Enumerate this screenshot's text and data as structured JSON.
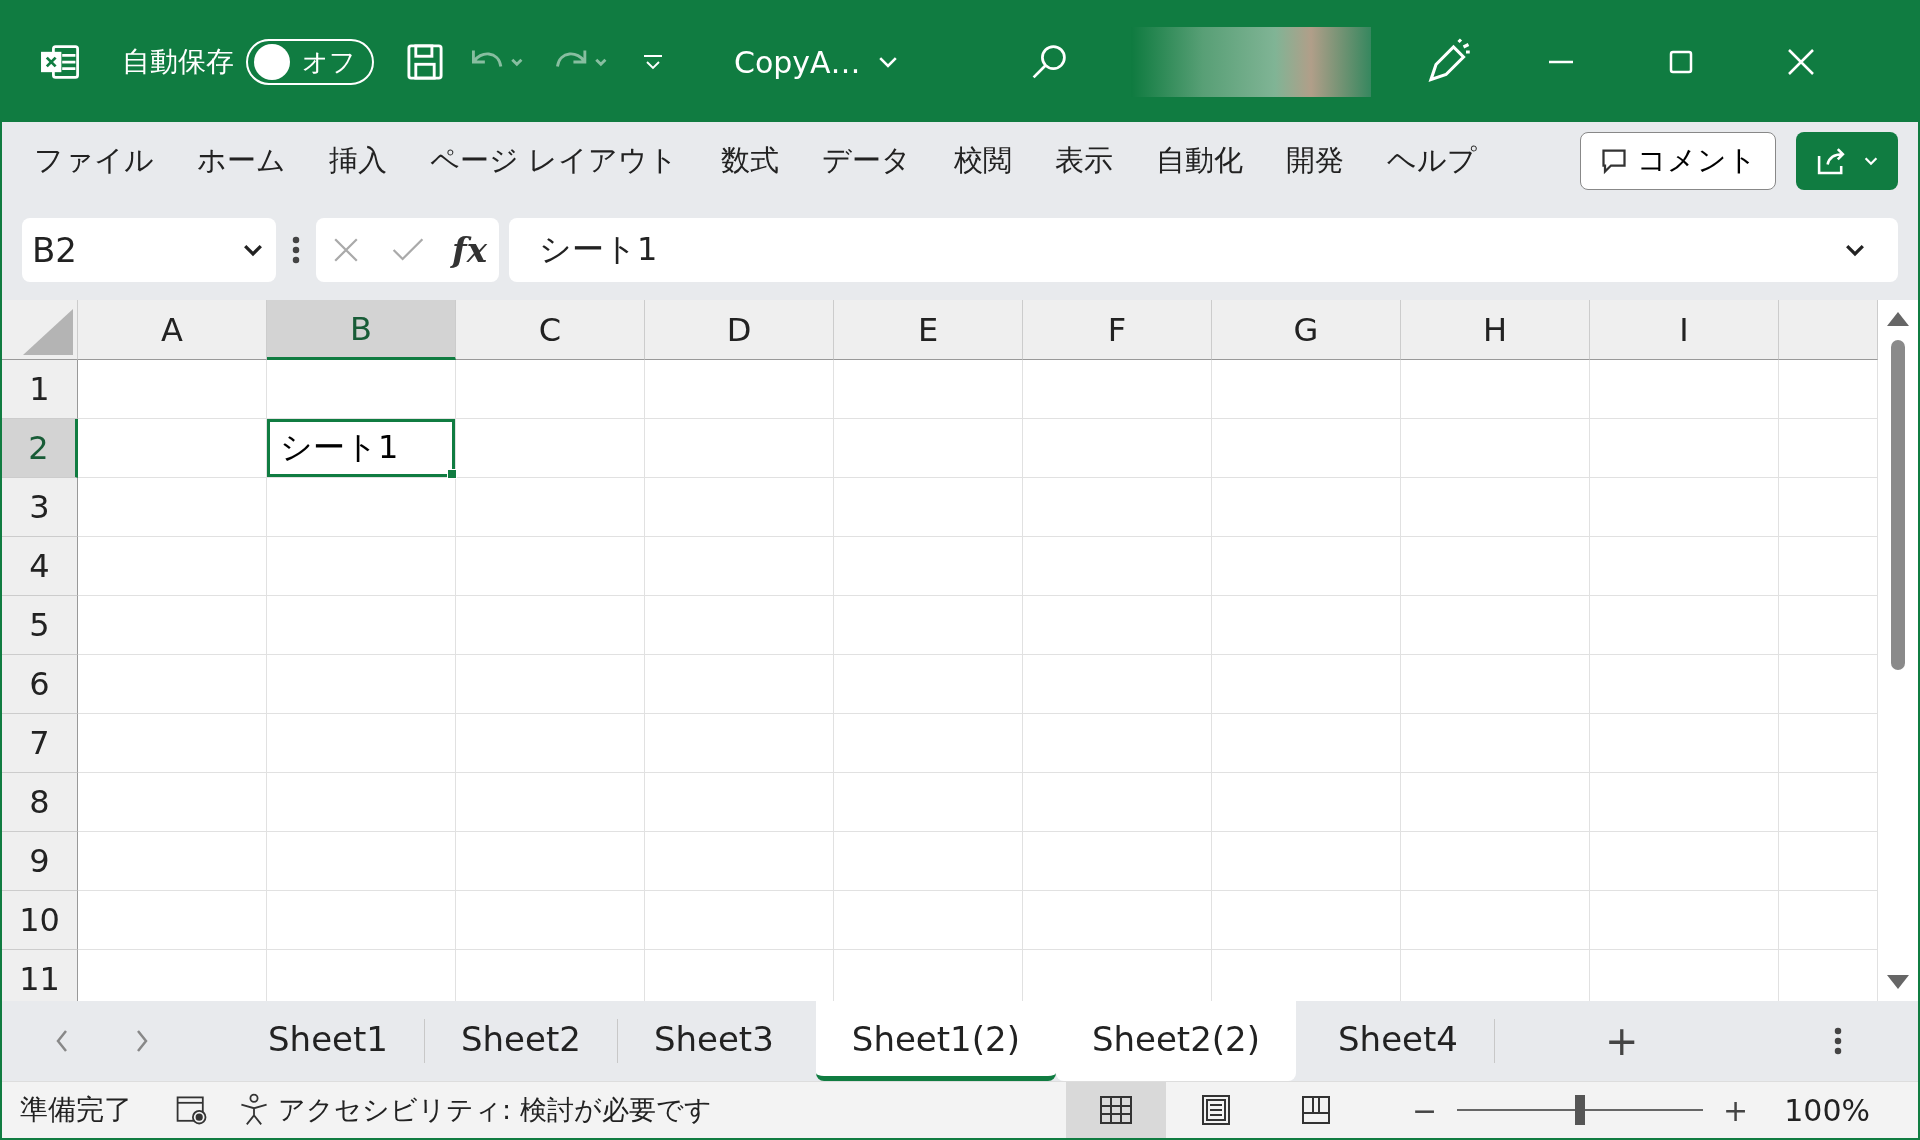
{
  "title_bar": {
    "autosave_label": "自動保存",
    "autosave": {
      "on": false,
      "label": "オフ"
    },
    "file_name": "CopyA…"
  },
  "ribbon_tabs": [
    {
      "label": "ファイル"
    },
    {
      "label": "ホーム"
    },
    {
      "label": "挿入"
    },
    {
      "label": "ページ レイアウト"
    },
    {
      "label": "数式"
    },
    {
      "label": "データ"
    },
    {
      "label": "校閲"
    },
    {
      "label": "表示"
    },
    {
      "label": "自動化"
    },
    {
      "label": "開発"
    },
    {
      "label": "ヘルプ"
    }
  ],
  "comment_button": "コメント",
  "formula_bar": {
    "name_box": "B2",
    "fx": "fx",
    "value": "シート1"
  },
  "grid": {
    "columns": [
      {
        "label": "A",
        "selected": false
      },
      {
        "label": "B",
        "selected": true
      },
      {
        "label": "C",
        "selected": false
      },
      {
        "label": "D",
        "selected": false
      },
      {
        "label": "E",
        "selected": false
      },
      {
        "label": "F",
        "selected": false
      },
      {
        "label": "G",
        "selected": false
      },
      {
        "label": "H",
        "selected": false
      },
      {
        "label": "I",
        "selected": false
      }
    ],
    "rows": [
      {
        "label": "1",
        "selected": false
      },
      {
        "label": "2",
        "selected": true
      },
      {
        "label": "3",
        "selected": false
      },
      {
        "label": "4",
        "selected": false
      },
      {
        "label": "5",
        "selected": false
      },
      {
        "label": "6",
        "selected": false
      },
      {
        "label": "7",
        "selected": false
      },
      {
        "label": "8",
        "selected": false
      },
      {
        "label": "9",
        "selected": false
      },
      {
        "label": "10",
        "selected": false
      },
      {
        "label": "11",
        "selected": false
      }
    ],
    "active_cell": {
      "value": "シート1"
    }
  },
  "sheet_tabs": [
    {
      "label": "Sheet1",
      "selected": false,
      "active": false
    },
    {
      "label": "Sheet2",
      "selected": false,
      "active": false
    },
    {
      "label": "Sheet3",
      "selected": false,
      "active": false
    },
    {
      "label": "Sheet1(2)",
      "selected": true,
      "active": true
    },
    {
      "label": "Sheet2(2)",
      "selected": true,
      "active": false
    },
    {
      "label": "Sheet4",
      "selected": false,
      "active": false
    }
  ],
  "add_sheet": "+",
  "status_bar": {
    "status": "準備完了",
    "accessibility": "アクセシビリティ: 検討が必要です",
    "views": [
      {
        "kind": "normal",
        "selected": true
      },
      {
        "kind": "page-layout",
        "selected": false
      },
      {
        "kind": "page-break",
        "selected": false
      }
    ],
    "zoom_minus": "−",
    "zoom_plus": "+",
    "zoom": {
      "level": 0.5
    },
    "zoom_text": "100%"
  }
}
